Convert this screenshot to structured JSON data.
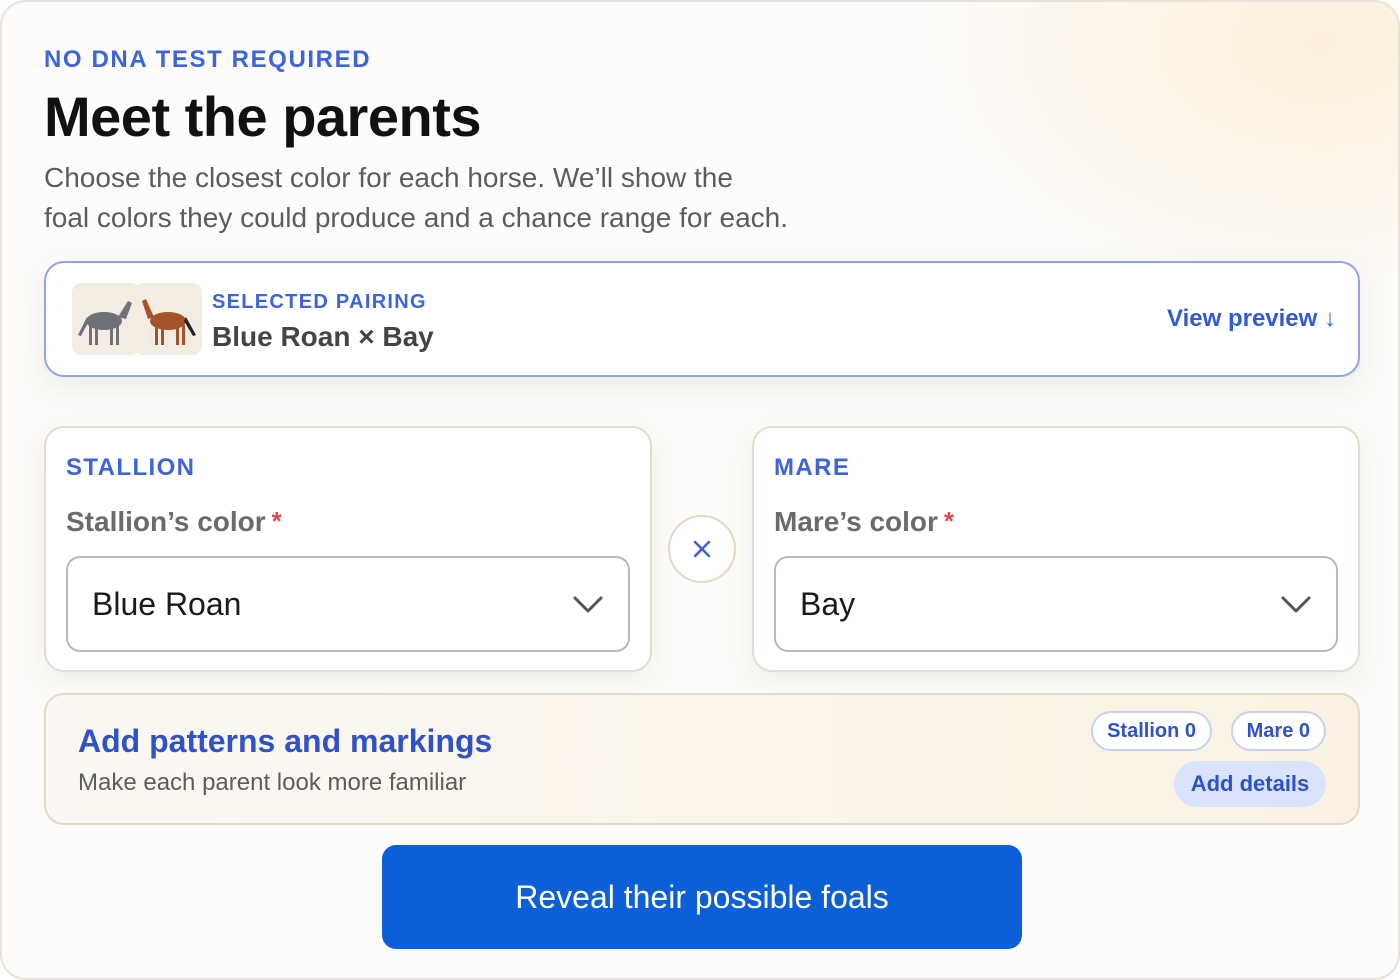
{
  "header": {
    "eyebrow": "NO DNA TEST REQUIRED",
    "title": "Meet the parents",
    "subtitle_line1": "Choose the closest color for each horse. We’ll show the",
    "subtitle_line2": "foal colors they could produce and a chance range for each."
  },
  "pairing": {
    "label": "SELECTED PAIRING",
    "value": "Blue Roan × Bay",
    "preview_link": "View preview ↓",
    "stallion_thumb_color": "#6f7278",
    "mare_thumb_color": "#a5532a"
  },
  "stallion": {
    "section_label": "STALLION",
    "field_label": "Stallion’s color",
    "required_mark": "*",
    "selected_value": "Blue Roan"
  },
  "mare": {
    "section_label": "MARE",
    "field_label": "Mare’s color",
    "required_mark": "*",
    "selected_value": "Bay"
  },
  "cross_icon": "close-x-icon",
  "patterns": {
    "title": "Add patterns and markings",
    "subtitle": "Make each parent look more familiar",
    "stallion_chip": "Stallion 0",
    "mare_chip": "Mare 0",
    "add_button": "Add details"
  },
  "cta": {
    "label": "Reveal their possible foals"
  },
  "colors": {
    "accent": "#3e63dd",
    "primary_button": "#0b5fd8",
    "required": "#e5484d"
  }
}
